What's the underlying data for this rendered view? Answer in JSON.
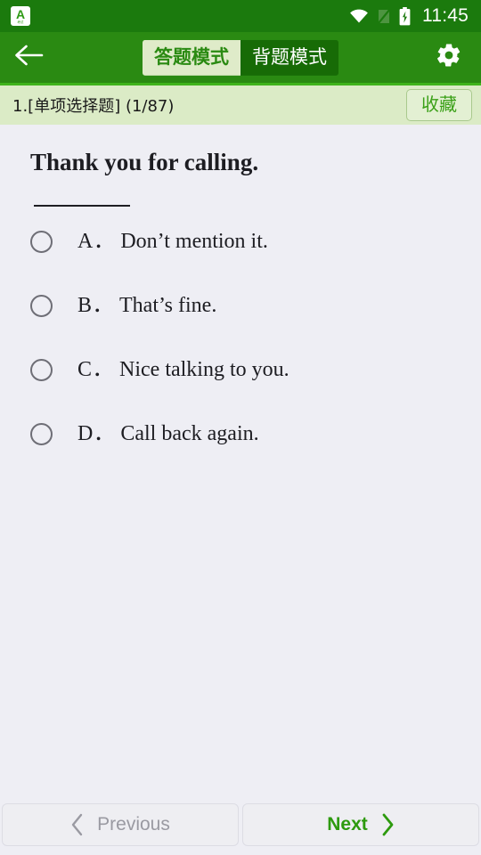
{
  "status_bar": {
    "app_icon_glyph": "A",
    "app_icon_sub": "考试",
    "icons": [
      "wifi-icon",
      "signal-off-icon",
      "battery-charging-icon"
    ],
    "time": "11:45",
    "background_color": "#1b7a0d"
  },
  "toolbar": {
    "back_icon": "arrow-left-icon",
    "settings_icon": "gear-icon",
    "background_color": "#2a8a12",
    "modes": [
      {
        "label": "答题模式",
        "active": true
      },
      {
        "label": "背题模式",
        "active": false
      }
    ]
  },
  "info_bar": {
    "question_info": "1.[单项选择题] (1/87)",
    "favorite_label": "收藏",
    "background_color": "#dbebc6",
    "favorite_color": "#3aa017"
  },
  "question": {
    "text": "Thank you for calling.",
    "has_blank_line": true,
    "options": [
      {
        "label": "A．",
        "text": "Don’t mention it.",
        "selected": false
      },
      {
        "label": "B．",
        "text": "That’s fine.",
        "selected": false
      },
      {
        "label": "C．",
        "text": "Nice talking to you.",
        "selected": false
      },
      {
        "label": "D．",
        "text": "Call back again.",
        "selected": false
      }
    ]
  },
  "bottom_nav": {
    "previous_label": "Previous",
    "previous_icon": "chevron-left-icon",
    "previous_disabled": true,
    "next_label": "Next",
    "next_icon": "chevron-right-icon",
    "next_color": "#2d9a0e",
    "disabled_color": "#9a9aa2"
  }
}
